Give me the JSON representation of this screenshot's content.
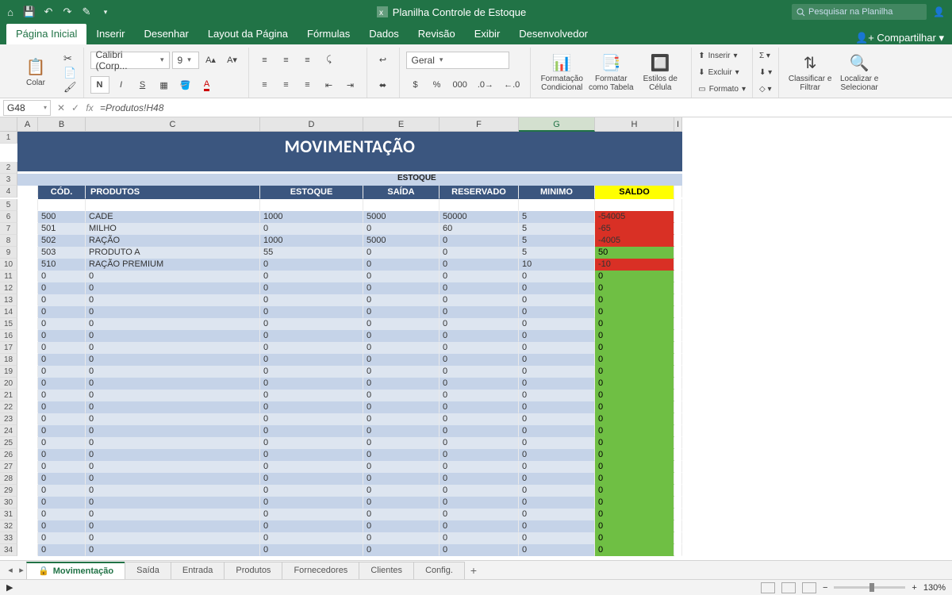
{
  "title": "Planilha Controle de Estoque",
  "search_placeholder": "Pesquisar na Planilha",
  "share": "Compartilhar",
  "tabs": [
    "Página Inicial",
    "Inserir",
    "Desenhar",
    "Layout da Página",
    "Fórmulas",
    "Dados",
    "Revisão",
    "Exibir",
    "Desenvolvedor"
  ],
  "active_tab": 0,
  "ribbon": {
    "paste": "Colar",
    "font_name": "Calibri (Corp...",
    "font_size": "9",
    "bold": "N",
    "italic": "I",
    "underline": "S",
    "number_format": "Geral",
    "cond_format": "Formatação Condicional",
    "format_table": "Formatar como Tabela",
    "cell_styles": "Estilos de Célula",
    "insert": "Inserir",
    "delete": "Excluir",
    "format": "Formato",
    "sort_filter": "Classificar e Filtrar",
    "find_select": "Localizar e Selecionar"
  },
  "namebox": "G48",
  "formula": "=Produtos!H48",
  "columns": [
    "A",
    "B",
    "C",
    "D",
    "E",
    "F",
    "G",
    "H",
    "I"
  ],
  "selected_col": "G",
  "sheet": {
    "title": "MOVIMENTAÇÃO",
    "group_header": "ESTOQUE",
    "headers": [
      "CÓD.",
      "PRODUTOS",
      "ESTOQUE",
      "SAÍDA",
      "RESERVADO",
      "MINIMO",
      "SALDO"
    ]
  },
  "rows": [
    {
      "cod": "500",
      "prod": "CADE",
      "est": "1000",
      "sai": "5000",
      "res": "50000",
      "min": "5",
      "saldo": "-54005",
      "color": "red"
    },
    {
      "cod": "501",
      "prod": "MILHO",
      "est": "0",
      "sai": "0",
      "res": "60",
      "min": "5",
      "saldo": "-65",
      "color": "red"
    },
    {
      "cod": "502",
      "prod": "RAÇÃO",
      "est": "1000",
      "sai": "5000",
      "res": "0",
      "min": "5",
      "saldo": "-4005",
      "color": "red"
    },
    {
      "cod": "503",
      "prod": "PRODUTO A",
      "est": "55",
      "sai": "0",
      "res": "0",
      "min": "5",
      "saldo": "50",
      "color": "green"
    },
    {
      "cod": "510",
      "prod": "RAÇÃO PREMIUM",
      "est": "0",
      "sai": "0",
      "res": "0",
      "min": "10",
      "saldo": "-10",
      "color": "red"
    },
    {
      "cod": "0",
      "prod": "0",
      "est": "0",
      "sai": "0",
      "res": "0",
      "min": "0",
      "saldo": "0",
      "color": "green"
    },
    {
      "cod": "0",
      "prod": "0",
      "est": "0",
      "sai": "0",
      "res": "0",
      "min": "0",
      "saldo": "0",
      "color": "green"
    },
    {
      "cod": "0",
      "prod": "0",
      "est": "0",
      "sai": "0",
      "res": "0",
      "min": "0",
      "saldo": "0",
      "color": "green"
    },
    {
      "cod": "0",
      "prod": "0",
      "est": "0",
      "sai": "0",
      "res": "0",
      "min": "0",
      "saldo": "0",
      "color": "green"
    },
    {
      "cod": "0",
      "prod": "0",
      "est": "0",
      "sai": "0",
      "res": "0",
      "min": "0",
      "saldo": "0",
      "color": "green"
    },
    {
      "cod": "0",
      "prod": "0",
      "est": "0",
      "sai": "0",
      "res": "0",
      "min": "0",
      "saldo": "0",
      "color": "green"
    },
    {
      "cod": "0",
      "prod": "0",
      "est": "0",
      "sai": "0",
      "res": "0",
      "min": "0",
      "saldo": "0",
      "color": "green"
    },
    {
      "cod": "0",
      "prod": "0",
      "est": "0",
      "sai": "0",
      "res": "0",
      "min": "0",
      "saldo": "0",
      "color": "green"
    },
    {
      "cod": "0",
      "prod": "0",
      "est": "0",
      "sai": "0",
      "res": "0",
      "min": "0",
      "saldo": "0",
      "color": "green"
    },
    {
      "cod": "0",
      "prod": "0",
      "est": "0",
      "sai": "0",
      "res": "0",
      "min": "0",
      "saldo": "0",
      "color": "green"
    },
    {
      "cod": "0",
      "prod": "0",
      "est": "0",
      "sai": "0",
      "res": "0",
      "min": "0",
      "saldo": "0",
      "color": "green"
    },
    {
      "cod": "0",
      "prod": "0",
      "est": "0",
      "sai": "0",
      "res": "0",
      "min": "0",
      "saldo": "0",
      "color": "green"
    },
    {
      "cod": "0",
      "prod": "0",
      "est": "0",
      "sai": "0",
      "res": "0",
      "min": "0",
      "saldo": "0",
      "color": "green"
    },
    {
      "cod": "0",
      "prod": "0",
      "est": "0",
      "sai": "0",
      "res": "0",
      "min": "0",
      "saldo": "0",
      "color": "green"
    },
    {
      "cod": "0",
      "prod": "0",
      "est": "0",
      "sai": "0",
      "res": "0",
      "min": "0",
      "saldo": "0",
      "color": "green"
    },
    {
      "cod": "0",
      "prod": "0",
      "est": "0",
      "sai": "0",
      "res": "0",
      "min": "0",
      "saldo": "0",
      "color": "green"
    },
    {
      "cod": "0",
      "prod": "0",
      "est": "0",
      "sai": "0",
      "res": "0",
      "min": "0",
      "saldo": "0",
      "color": "green"
    },
    {
      "cod": "0",
      "prod": "0",
      "est": "0",
      "sai": "0",
      "res": "0",
      "min": "0",
      "saldo": "0",
      "color": "green"
    },
    {
      "cod": "0",
      "prod": "0",
      "est": "0",
      "sai": "0",
      "res": "0",
      "min": "0",
      "saldo": "0",
      "color": "green"
    },
    {
      "cod": "0",
      "prod": "0",
      "est": "0",
      "sai": "0",
      "res": "0",
      "min": "0",
      "saldo": "0",
      "color": "green"
    },
    {
      "cod": "0",
      "prod": "0",
      "est": "0",
      "sai": "0",
      "res": "0",
      "min": "0",
      "saldo": "0",
      "color": "green"
    },
    {
      "cod": "0",
      "prod": "0",
      "est": "0",
      "sai": "0",
      "res": "0",
      "min": "0",
      "saldo": "0",
      "color": "green"
    },
    {
      "cod": "0",
      "prod": "0",
      "est": "0",
      "sai": "0",
      "res": "0",
      "min": "0",
      "saldo": "0",
      "color": "green"
    },
    {
      "cod": "0",
      "prod": "0",
      "est": "0",
      "sai": "0",
      "res": "0",
      "min": "0",
      "saldo": "0",
      "color": "green"
    }
  ],
  "sheet_tabs": [
    "Movimentação",
    "Saída",
    "Entrada",
    "Produtos",
    "Fornecedores",
    "Clientes",
    "Config."
  ],
  "active_sheet": 0,
  "zoom": "130%"
}
